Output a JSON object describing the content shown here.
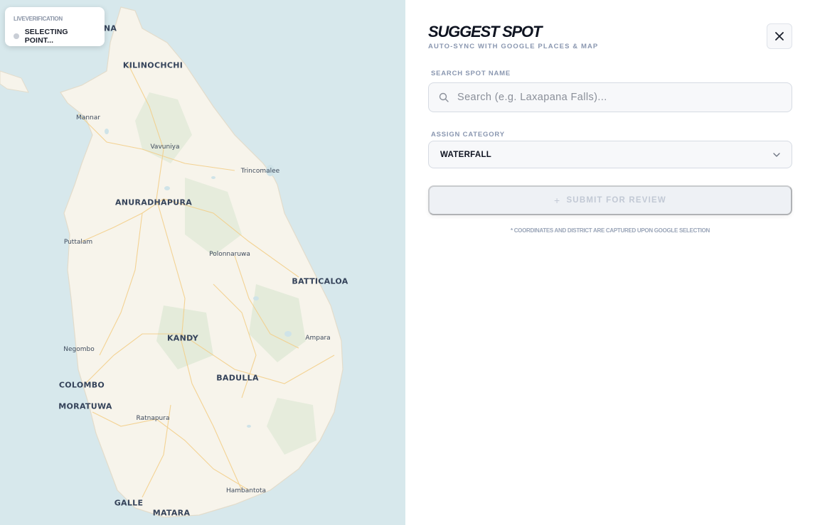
{
  "map": {
    "status_card": {
      "title": "LIVEVERIFICATION",
      "status": "SELECTING POINT..."
    },
    "labels": [
      {
        "name": "NA",
        "size": "big"
      },
      {
        "name": "KILINOCHCHI",
        "size": "big"
      },
      {
        "name": "Mannar",
        "size": "small"
      },
      {
        "name": "Vavuniya",
        "size": "small"
      },
      {
        "name": "Trincomalee",
        "size": "small"
      },
      {
        "name": "ANURADHAPURA",
        "size": "big"
      },
      {
        "name": "Puttalam",
        "size": "small"
      },
      {
        "name": "Polonnaruwa",
        "size": "small"
      },
      {
        "name": "BATTICALOA",
        "size": "big"
      },
      {
        "name": "KANDY",
        "size": "big"
      },
      {
        "name": "Ampara",
        "size": "small"
      },
      {
        "name": "Negombo",
        "size": "small"
      },
      {
        "name": "COLOMBO",
        "size": "big"
      },
      {
        "name": "BADULLA",
        "size": "big"
      },
      {
        "name": "MORATUWA",
        "size": "big"
      },
      {
        "name": "Ratnapura",
        "size": "small"
      },
      {
        "name": "Hambantota",
        "size": "small"
      },
      {
        "name": "GALLE",
        "size": "big"
      },
      {
        "name": "MATARA",
        "size": "big"
      }
    ],
    "colors": {
      "sea": "#d7e8ec",
      "land": "#f6f3ea",
      "roads": "#f3c97a",
      "parks": "#e3ead8"
    }
  },
  "panel": {
    "title": "SUGGEST SPOT",
    "subtitle": "AUTO-SYNC WITH GOOGLE PLACES & MAP",
    "close_icon": "close-icon",
    "search": {
      "label": "SEARCH SPOT NAME",
      "placeholder": "Search (e.g. Laxapana Falls)...",
      "value": ""
    },
    "category": {
      "label": "ASSIGN CATEGORY",
      "selected": "WATERFALL"
    },
    "submit_label": "SUBMIT FOR REVIEW",
    "note": "* COORDINATES AND DISTRICT ARE CAPTURED UPON GOOGLE SELECTION"
  }
}
